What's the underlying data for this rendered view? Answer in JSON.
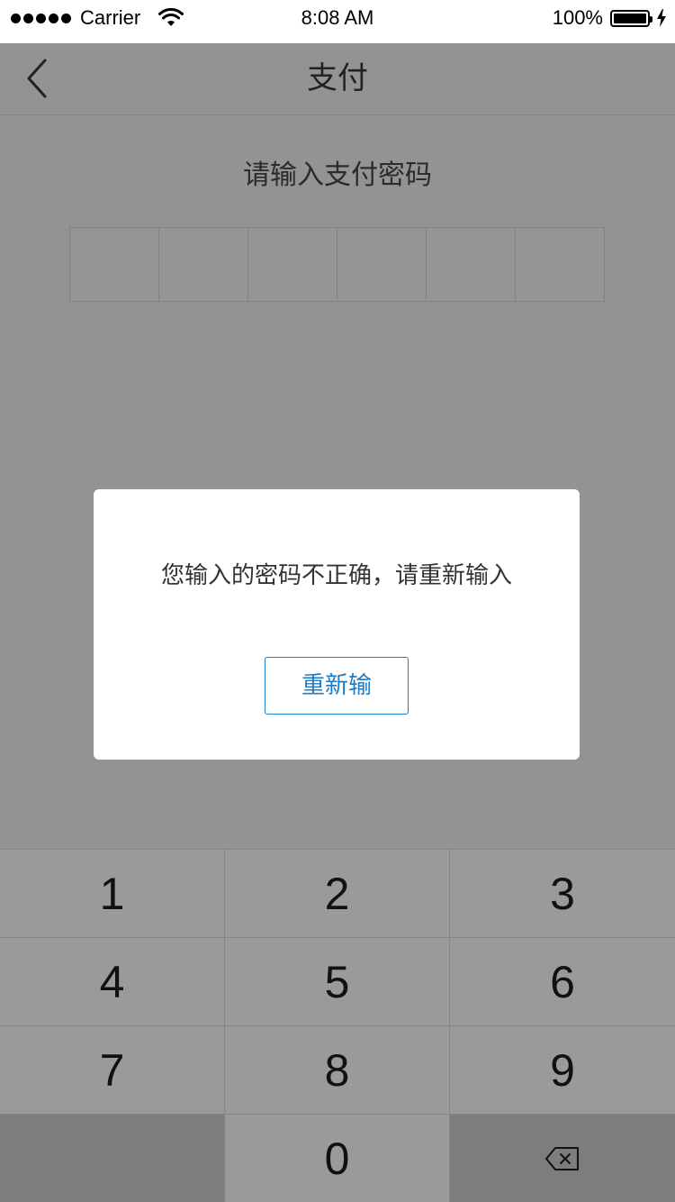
{
  "status_bar": {
    "carrier": "Carrier",
    "time": "8:08 AM",
    "battery": "100%",
    "battery_level": 1.0,
    "signal_icon": "signal-dots-icon",
    "wifi_icon": "wifi-icon",
    "charging_icon": "bolt-icon"
  },
  "nav": {
    "title": "支付",
    "back_icon": "chevron-left-icon"
  },
  "payment": {
    "prompt": "请输入支付密码",
    "digits": [
      "",
      "",
      "",
      "",
      "",
      ""
    ]
  },
  "dialog": {
    "message": "您输入的密码不正确，请重新输入",
    "button_label": "重新输"
  },
  "keypad": {
    "keys": [
      "1",
      "2",
      "3",
      "4",
      "5",
      "6",
      "7",
      "8",
      "9",
      "",
      "0",
      ""
    ],
    "delete_icon": "backspace-icon"
  },
  "colors": {
    "overlay_background": "#939393",
    "accent": "#1f7cc4",
    "dialog_background": "#ffffff"
  }
}
